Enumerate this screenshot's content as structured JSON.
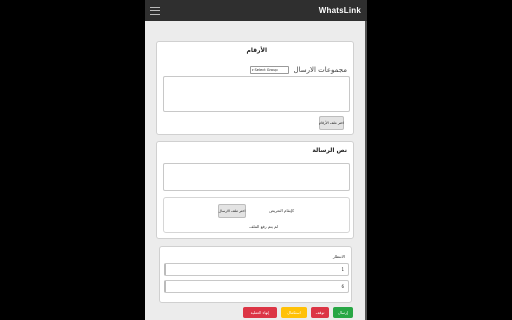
{
  "header": {
    "brand": "WhatsLink",
    "menu_icon": "hamburger-icon"
  },
  "numbers_card": {
    "title": "الأرقام",
    "groups_label": "مجموعات الارسال",
    "group_select": {
      "selected": "Select Group"
    },
    "numbers_textarea": {
      "value": ""
    },
    "choose_numbers_file_label": "اختر ملف الأرقام"
  },
  "message_card": {
    "title": "نص الرسالة",
    "message_textarea": {
      "value": ""
    },
    "choose_send_file_label": "اختر ملف الارسال",
    "offer_checkbox_label": "كإيقام التعريض",
    "file_status": "لم يتم رفع الملف"
  },
  "wait_card": {
    "title": "الانتظار",
    "wait_min": "1",
    "wait_max": "6"
  },
  "actions": {
    "send": {
      "label": "إرسال",
      "color": "#28a745"
    },
    "stop": {
      "label": "توقف",
      "color": "#dc3545"
    },
    "continue": {
      "label": "استكمال",
      "color": "#ffc107"
    },
    "finish": {
      "label": "إنهاء العملية",
      "color": "#dc3545"
    }
  }
}
